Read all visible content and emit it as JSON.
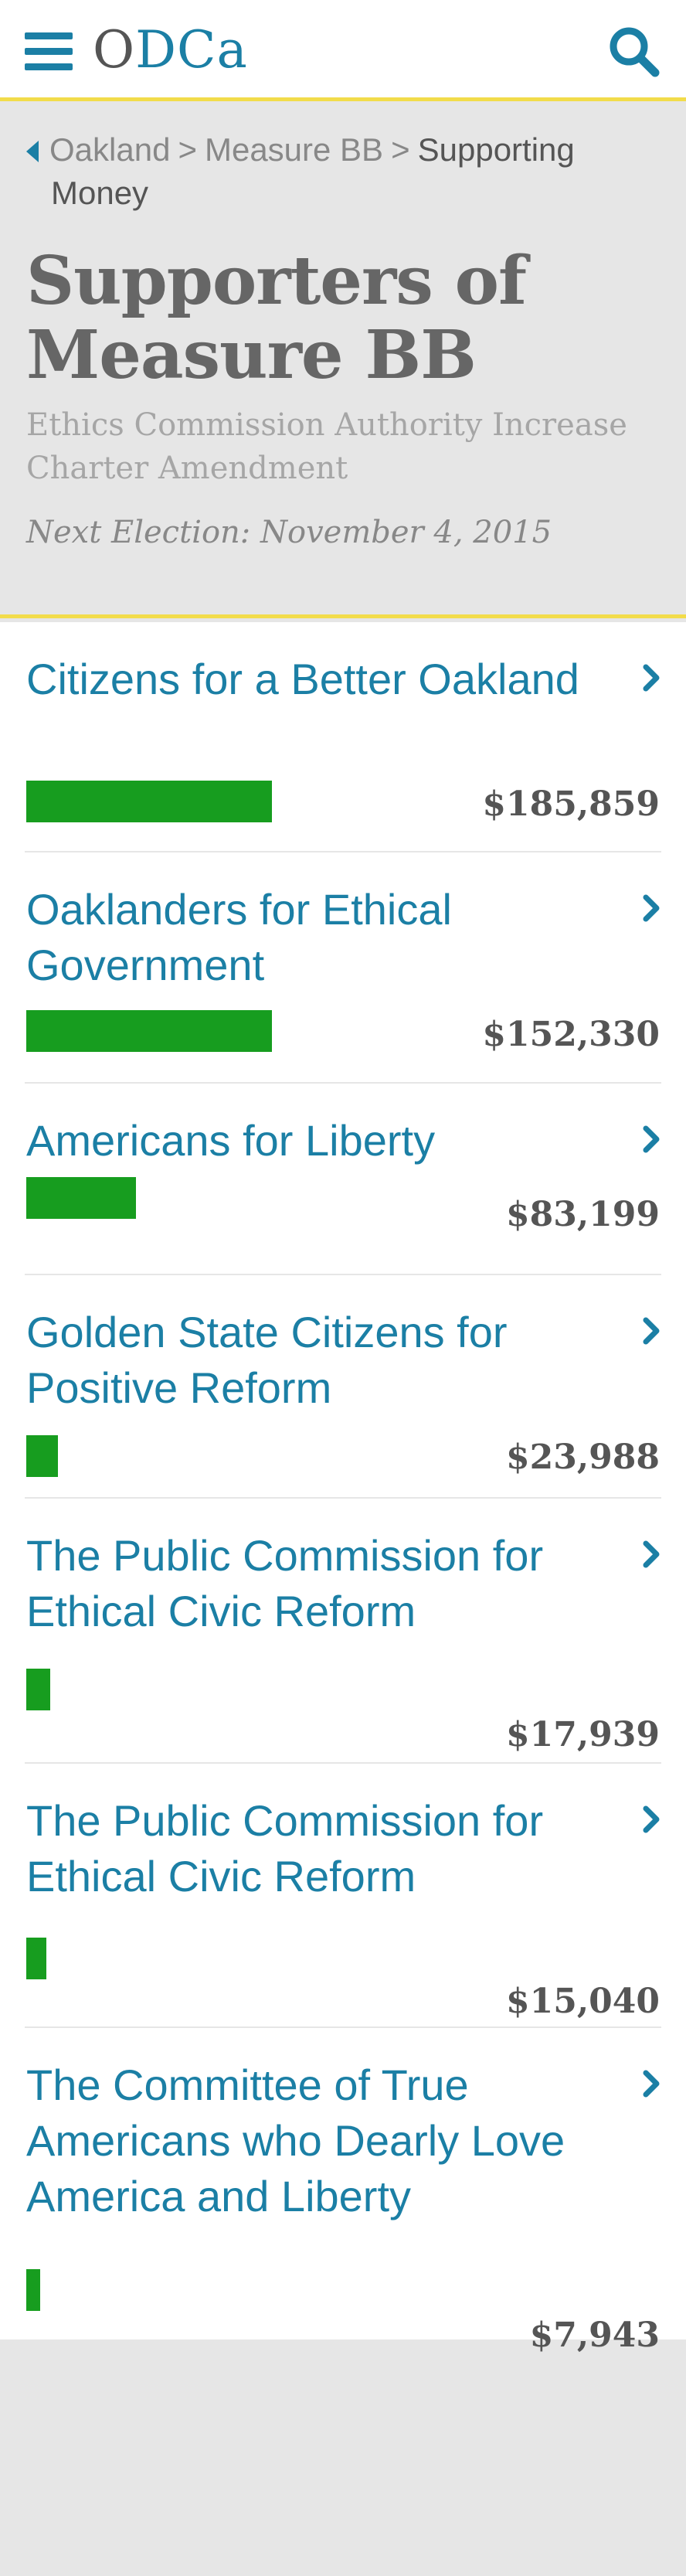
{
  "header": {
    "logo_prefix": "O",
    "logo_rest": "DCa",
    "menu_icon": "hamburger-menu-icon",
    "search_icon": "search-icon",
    "accent_color": "#1b7fa5",
    "divider_color": "#f2dc4a"
  },
  "breadcrumb": {
    "items": [
      "Oakland",
      "Measure BB"
    ],
    "current_line1": "Supporting",
    "current_line2": "Money"
  },
  "hero": {
    "title_line1": "Supporters of",
    "title_line2": "Measure BB",
    "subtitle_line1": "Ethics Commission Authority Increase",
    "subtitle_line2": "Charter Amendment",
    "next_election": "Next Election: November 4, 2015"
  },
  "bar_color": "#179d1f",
  "supporters": [
    {
      "name": "Citizens for a Better Oakland",
      "amount": "$185,859",
      "value": 185859
    },
    {
      "name": "Oaklanders for Ethical Government",
      "amount": "$152,330",
      "value": 152330
    },
    {
      "name": "Americans for Liberty",
      "amount": "$83,199",
      "value": 83199
    },
    {
      "name": "Golden State Citizens for Positive Reform",
      "amount": "$23,988",
      "value": 23988
    },
    {
      "name": "The Public Commission for Ethical Civic Reform",
      "amount": "$17,939",
      "value": 17939
    },
    {
      "name": "The Public Commission for Ethical Civic Reform",
      "amount": "$15,040",
      "value": 15040
    },
    {
      "name": "The Committee of True Americans who Dearly Love America and Liberty",
      "amount": "$7,943",
      "value": 7943
    }
  ]
}
